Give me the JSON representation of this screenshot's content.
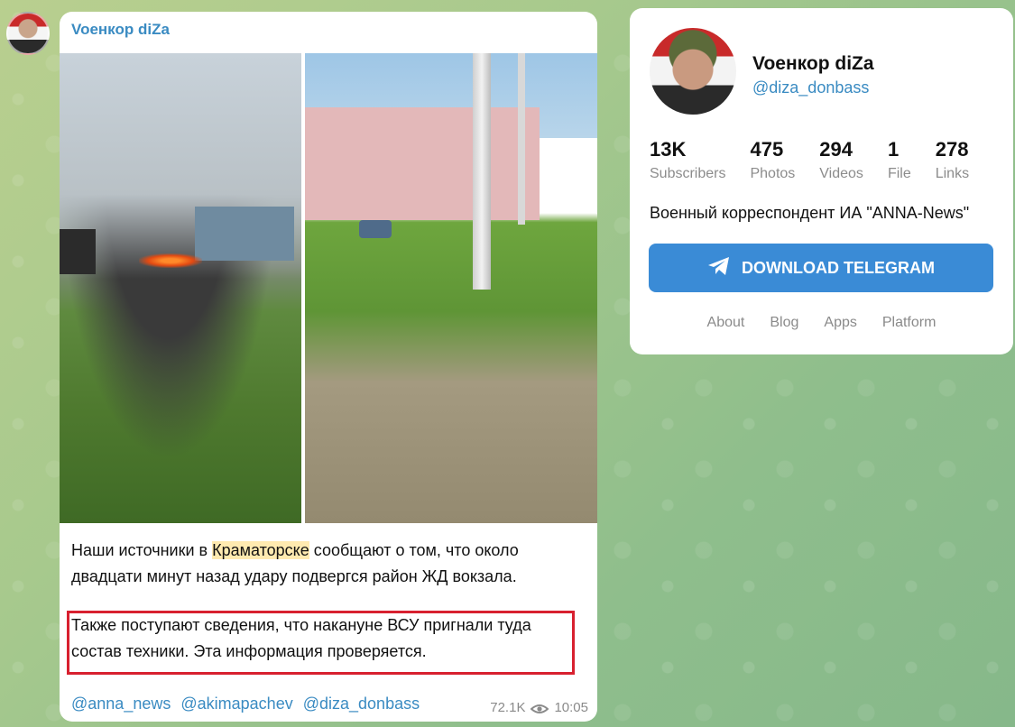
{
  "post": {
    "author": "Voенкор diZa",
    "text_before_highlight": "Наши источники в ",
    "text_highlight": "Краматорске",
    "text_after_highlight": " сообщают о том, что около двадцати минут назад удару подвергся район ЖД вокзала.",
    "text_second": "Также поступают сведения, что накануне ВСУ пригнали туда состав техники. Эта информация проверяется.",
    "links": [
      "@anna_news",
      "@akimapachev",
      "@diza_donbass"
    ],
    "views": "72.1K",
    "time": "10:05",
    "accent_color": "#3a8bc2",
    "highlight_box_color": "#d8202f"
  },
  "channel": {
    "name": "Voенкор diZa",
    "handle": "@diza_donbass",
    "stats": [
      {
        "num": "13K",
        "label": "Subscribers"
      },
      {
        "num": "475",
        "label": "Photos"
      },
      {
        "num": "294",
        "label": "Videos"
      },
      {
        "num": "1",
        "label": "File"
      },
      {
        "num": "278",
        "label": "Links"
      }
    ],
    "description": "Военный корреспондент ИА \"ANNA-News\"",
    "download_button": "DOWNLOAD TELEGRAM",
    "footer_links": [
      "About",
      "Blog",
      "Apps",
      "Platform"
    ],
    "button_color": "#3a8bd6"
  }
}
